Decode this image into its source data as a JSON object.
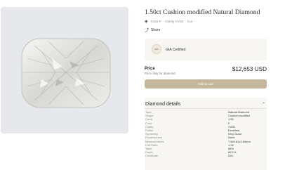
{
  "product": {
    "title": "1.50ct Cushion modified Natural Diamond",
    "spec_summary": [
      "Color F",
      "Clarity VVS2",
      "Cut -"
    ],
    "share_label": "Share"
  },
  "certificate": {
    "label": "GIA Certified",
    "badge_text": "GIA"
  },
  "price": {
    "label": "Price",
    "sublabel": "Price only for diamond",
    "value": "$12,653 USD"
  },
  "cart_button_label": "Add to cart",
  "details": {
    "heading": "Diamond details",
    "rows": [
      {
        "key": "Type",
        "value": "Natural Diamond"
      },
      {
        "key": "Shape",
        "value": "Cushion modified"
      },
      {
        "key": "Carat",
        "value": "1.50"
      },
      {
        "key": "Color",
        "value": "F"
      },
      {
        "key": "Clarity",
        "value": "VVS2"
      },
      {
        "key": "Polish",
        "value": "Excellent"
      },
      {
        "key": "Symmetry",
        "value": "Very Good"
      },
      {
        "key": "Fluorescence",
        "value": "None"
      },
      {
        "key": "Measurements",
        "value": "7.8x5.81x3.84mm"
      },
      {
        "key": "L/W Ratio",
        "value": "1.34"
      },
      {
        "key": "Table",
        "value": "68%"
      },
      {
        "key": "Depth",
        "value": "66.1%"
      },
      {
        "key": "Certificate",
        "value": "GIA"
      }
    ]
  },
  "icons": {
    "tag": "tag-icon",
    "share": "share-icon",
    "camera": "camera-icon",
    "chevron": "chevron-up-icon"
  },
  "colors": {
    "button_bg": "#c5b79b",
    "panel_bg": "#f7f6f3",
    "gallery_bg": "#e7e8ec"
  }
}
